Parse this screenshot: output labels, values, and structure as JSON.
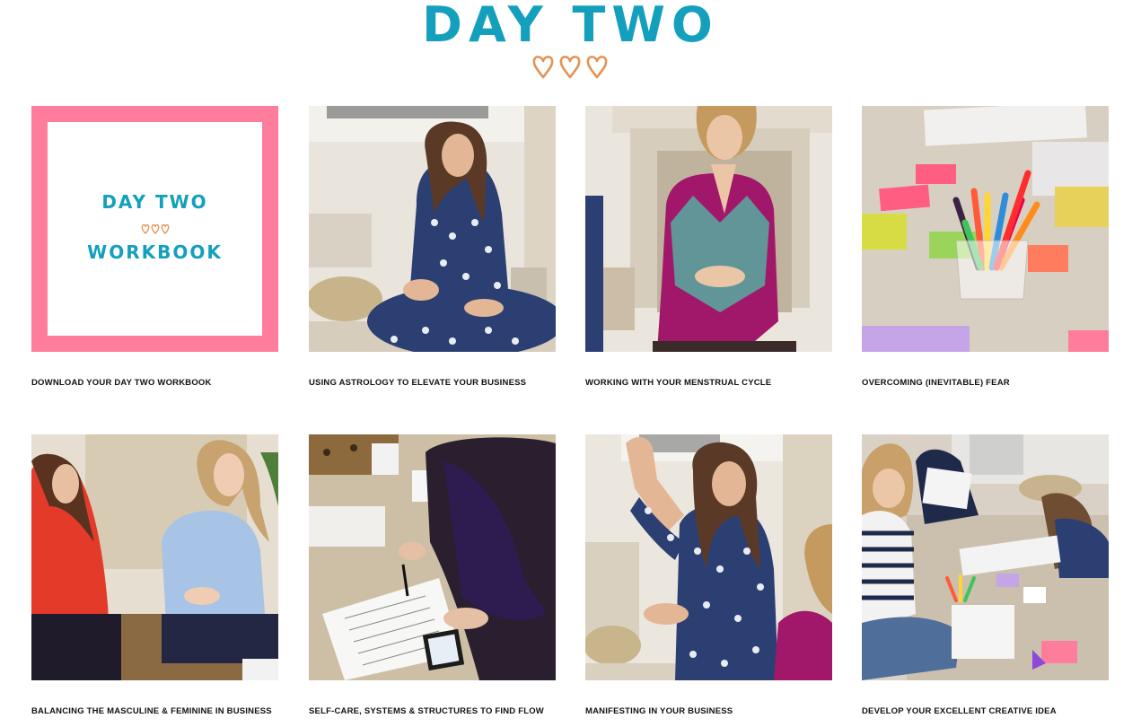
{
  "page": {
    "title": "DAY TWO"
  },
  "workbook_tile": {
    "line1": "DAY TWO",
    "line2": "WORKBOOK"
  },
  "cards": [
    {
      "caption": "DOWNLOAD YOUR DAY TWO WORKBOOK",
      "image": "workbook-cover"
    },
    {
      "caption": "USING ASTROLOGY TO ELEVATE YOUR BUSINESS",
      "image": "woman-in-polka-dot-dress-seated"
    },
    {
      "caption": "WORKING WITH YOUR MENSTRUAL CYCLE",
      "image": "woman-in-magenta-dress-standing"
    },
    {
      "caption": "OVERCOMING (INEVITABLE) FEAR",
      "image": "pen-pot-and-sticky-notes-on-rug"
    },
    {
      "caption": "BALANCING THE MASCULINE & FEMININE IN BUSINESS",
      "image": "two-women-talking-on-floor"
    },
    {
      "caption": "SELF-CARE, SYSTEMS & STRUCTURES TO FIND FLOW",
      "image": "writing-notes-on-rug-with-phone"
    },
    {
      "caption": "MANIFESTING IN YOUR BUSINESS",
      "image": "woman-raising-hand-speaking"
    },
    {
      "caption": "DEVELOP YOUR EXCELLENT CREATIVE IDEA",
      "image": "group-workshop-on-floor"
    }
  ],
  "colors": {
    "brand_teal": "#14a0bd",
    "heart_orange": "#e39253",
    "workbook_pink": "#ff7d9c"
  }
}
